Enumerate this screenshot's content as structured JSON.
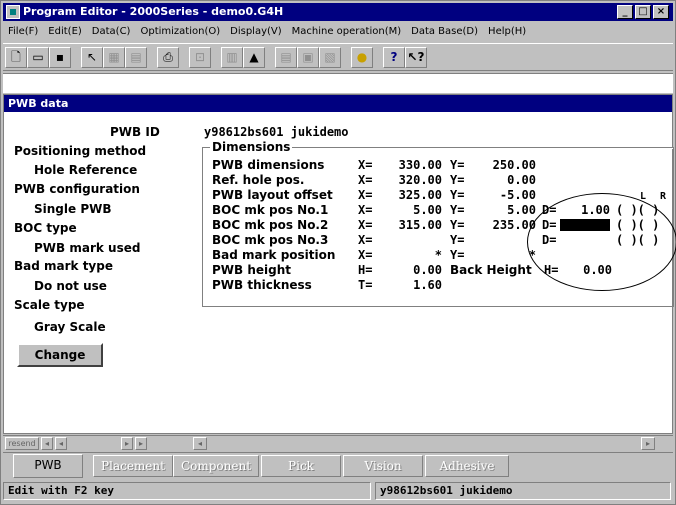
{
  "window": {
    "title": "Program Editor - 2000Series - demo0.G4H",
    "btn_min": "_",
    "btn_max": "□",
    "btn_close": "×"
  },
  "menu": [
    "File(F)",
    "Edit(E)",
    "Data(C)",
    "Optimization(O)",
    "Display(V)",
    "Machine operation(M)",
    "Data Base(D)",
    "Help(H)"
  ],
  "toolbar": {
    "icons": [
      "new-file-icon",
      "open-folder-icon",
      "save-icon",
      "pointer-icon",
      "table-icon",
      "table2-icon",
      "print-icon",
      "zoom-icon",
      "grid-icon",
      "chart-icon",
      "list-icon",
      "chip-icon",
      "form-icon",
      "bulb-icon",
      "question-icon",
      "help-pointer-icon"
    ]
  },
  "panel": {
    "title": "PWB data",
    "pwb_id_label": "PWB ID",
    "pwb_id_value": "y98612bs601  jukidemo",
    "positioning_method_label": "Positioning method",
    "positioning_method_value": "Hole Reference",
    "pwb_config_label": "PWB configuration",
    "pwb_config_value": "Single PWB",
    "boc_type_label": "BOC type",
    "boc_type_value": "PWB mark used",
    "bad_mark_type_label": "Bad mark type",
    "bad_mark_type_value": "Do not use",
    "scale_type_label": "Scale type",
    "scale_type_value": "Gray Scale",
    "change_button": "Change"
  },
  "dimensions": {
    "title": "Dimensions",
    "rows": [
      {
        "label": "PWB dimensions",
        "xk": "X=",
        "x": "330.00",
        "yk": "Y=",
        "y": "250.00"
      },
      {
        "label": "Ref. hole pos.",
        "xk": "X=",
        "x": "320.00",
        "yk": "Y=",
        "y": "0.00"
      },
      {
        "label": "PWB layout offset",
        "xk": "X=",
        "x": "325.00",
        "yk": "Y=",
        "y": "-5.00"
      },
      {
        "label": "BOC mk pos No.1",
        "xk": "X=",
        "x": "5.00",
        "yk": "Y=",
        "y": "5.00"
      },
      {
        "label": "BOC mk pos No.2",
        "xk": "X=",
        "x": "315.00",
        "yk": "Y=",
        "y": "235.00"
      },
      {
        "label": "BOC mk pos No.3",
        "xk": "X=",
        "x": "",
        "yk": "Y=",
        "y": ""
      },
      {
        "label": "Bad mark position",
        "xk": "X=",
        "x": "*",
        "yk": "Y=",
        "y": "*"
      },
      {
        "label": "PWB height",
        "xk": "H=",
        "x": "0.00",
        "yk": "Back Height",
        "y": ""
      },
      {
        "label": "PWB thickness",
        "xk": "T=",
        "x": "1.60",
        "yk": "",
        "y": ""
      }
    ],
    "back_height_key": "H=",
    "back_height_value": "0.00",
    "lr_header_l": "L",
    "lr_header_r": "R",
    "d1_key": "D=",
    "d1_value": "1.00",
    "d2_key": "D=",
    "d3_key": "D=",
    "paren": "(  )(  )"
  },
  "scroll": {
    "left_label": "resend"
  },
  "tabs": [
    "PWB",
    "Placement",
    "Component",
    "Pick",
    "Vision",
    "Adhesive"
  ],
  "status": {
    "message": "Edit with F2 key",
    "file_info": "y98612bs601   jukidemo"
  }
}
